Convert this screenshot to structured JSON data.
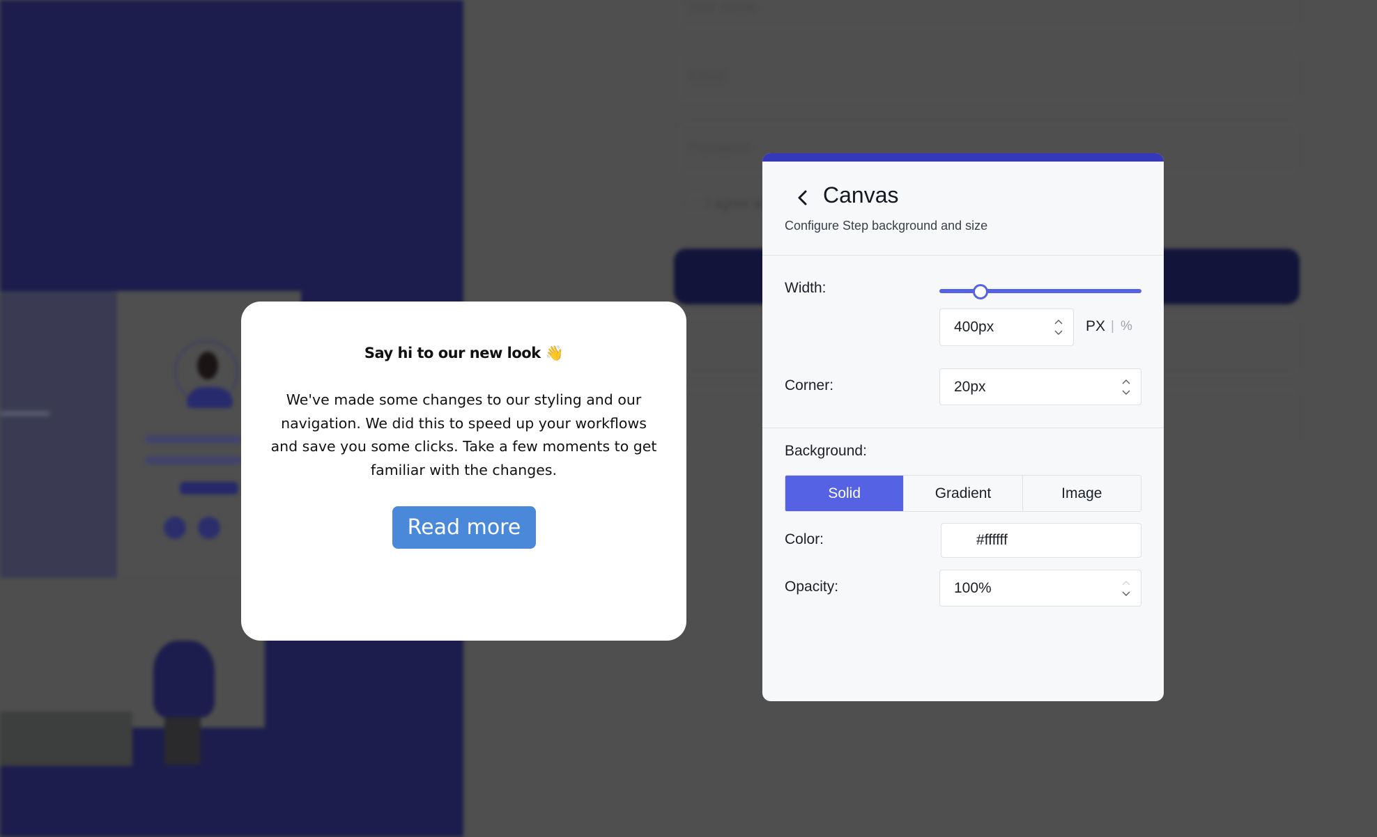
{
  "background": {
    "form": {
      "fields": [
        {
          "placeholder": "Your name"
        },
        {
          "placeholder": "Email"
        },
        {
          "placeholder": "Password"
        }
      ],
      "agree_label": "I agree w"
    }
  },
  "modal": {
    "title": "Say hi to our new look 👋",
    "body": "We've made some changes to our styling and our navigation. We did this to speed up your workflows and save you some clicks. Take a few moments to get familiar with the changes.",
    "button_label": "Read more",
    "button_color": "#4a88d9"
  },
  "panel": {
    "accent_color": "#3538b8",
    "back_icon": "chevron-left-icon",
    "title": "Canvas",
    "subtitle": "Configure Step background and size",
    "width": {
      "label": "Width:",
      "slider_fraction": 0.2,
      "value": "400px",
      "unit_px": "PX",
      "unit_separator": "|",
      "unit_percent": "%",
      "active_unit": "PX"
    },
    "corner": {
      "label": "Corner:",
      "value": "20px"
    },
    "background": {
      "label": "Background:",
      "tabs": [
        {
          "label": "Solid",
          "active": true
        },
        {
          "label": "Gradient",
          "active": false
        },
        {
          "label": "Image",
          "active": false
        }
      ],
      "active_color": "#5562e4"
    },
    "color": {
      "label": "Color:",
      "value": "#ffffff"
    },
    "opacity": {
      "label": "Opacity:",
      "value": "100%"
    }
  }
}
